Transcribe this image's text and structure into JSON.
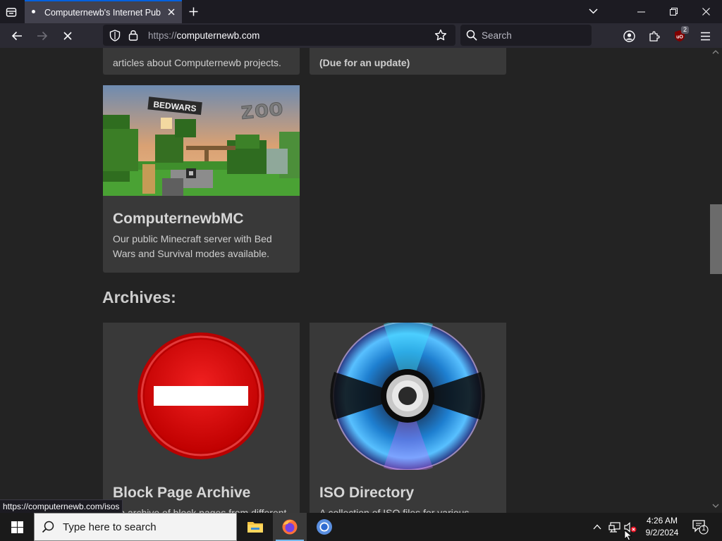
{
  "browser": {
    "tab": {
      "title": "Computernewb's Internet Pub Hub"
    },
    "url": {
      "protocol": "https://",
      "host": "computernewb.com"
    },
    "search": {
      "placeholder": "Search"
    },
    "ublock_count": "2",
    "status_url": "https://computernewb.com/isos"
  },
  "page": {
    "partial_card_left_text": "articles about Computernewb projects.",
    "partial_card_right_text": "(Due for an update)",
    "mc_card": {
      "image_sign_text": "BEDWARS",
      "image_zoo_text": "zoo",
      "title": "ComputernewbMC",
      "description_line1": "Our public Minecraft server with Bed",
      "description_line2": "Wars and Survival modes available."
    },
    "archives_heading": "Archives:",
    "block_card": {
      "title": "Block Page Archive",
      "description": "An archive of block pages from different"
    },
    "iso_card": {
      "title": "ISO Directory",
      "description": "A collection of ISO files for various"
    }
  },
  "taskbar": {
    "search_placeholder": "Type here to search",
    "time": "4:26 AM",
    "date": "9/2/2024",
    "notification_count": "1"
  }
}
